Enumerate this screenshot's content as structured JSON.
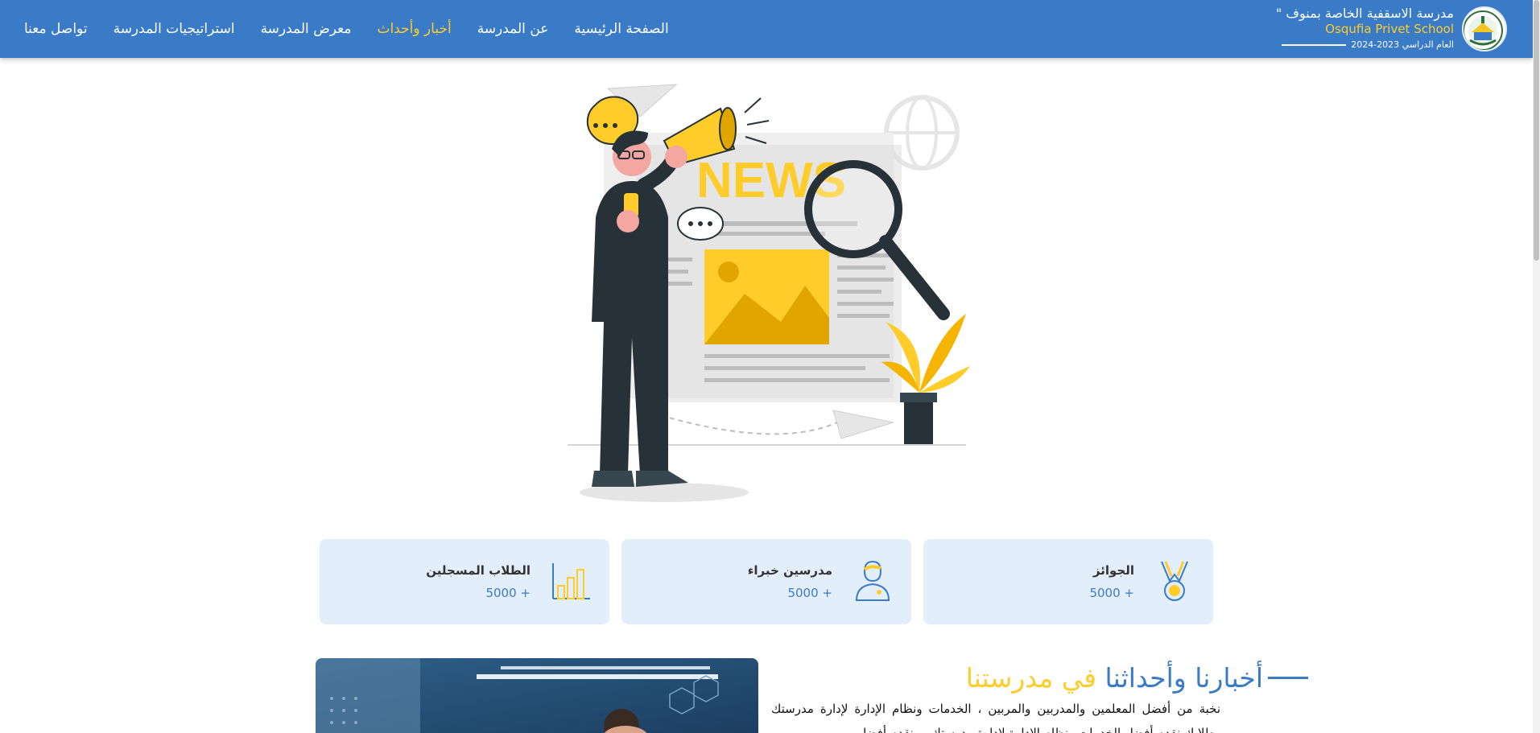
{
  "brand": {
    "name_ar": "مدرسة الاسقفية الخاصة بمنوف \"",
    "name_en": "Osqufia Privet School",
    "year_label": "العام الدراسي 2023-2024"
  },
  "nav": {
    "items": [
      {
        "label": "الصفحة الرئيسية",
        "active": false
      },
      {
        "label": "عن المدرسة",
        "active": false
      },
      {
        "label": "أخبار وأحداث",
        "active": true
      },
      {
        "label": "معرض المدرسة",
        "active": false
      },
      {
        "label": "استراتيجيات المدرسة",
        "active": false
      },
      {
        "label": "تواصل معنا",
        "active": false
      }
    ]
  },
  "hero": {
    "news_word": "NEWS"
  },
  "stats": [
    {
      "title": "الجوائز",
      "count": "+ 5000",
      "icon": "medal-icon"
    },
    {
      "title": "مدرسين خبراء",
      "count": "+ 5000",
      "icon": "teacher-icon"
    },
    {
      "title": "الطلاب المسجلين",
      "count": "+ 5000",
      "icon": "bar-chart-icon"
    }
  ],
  "news_section": {
    "title_main": "أخبارنا وأحداثنا ",
    "title_accent": "في مدرستنا",
    "text": "نخبة من أفضل المعلمين والمدربين والمربين ، الخدمات ونظام الإدارة لإدارة مدرستك وطلابك نقدم أفضل الخدمات ونظام الإدارة لإدارة مدرستك ، ونقدم أفضل"
  },
  "colors": {
    "primary": "#3a7bc8",
    "accent": "#ffcc29",
    "card_bg": "#e3eefb"
  }
}
